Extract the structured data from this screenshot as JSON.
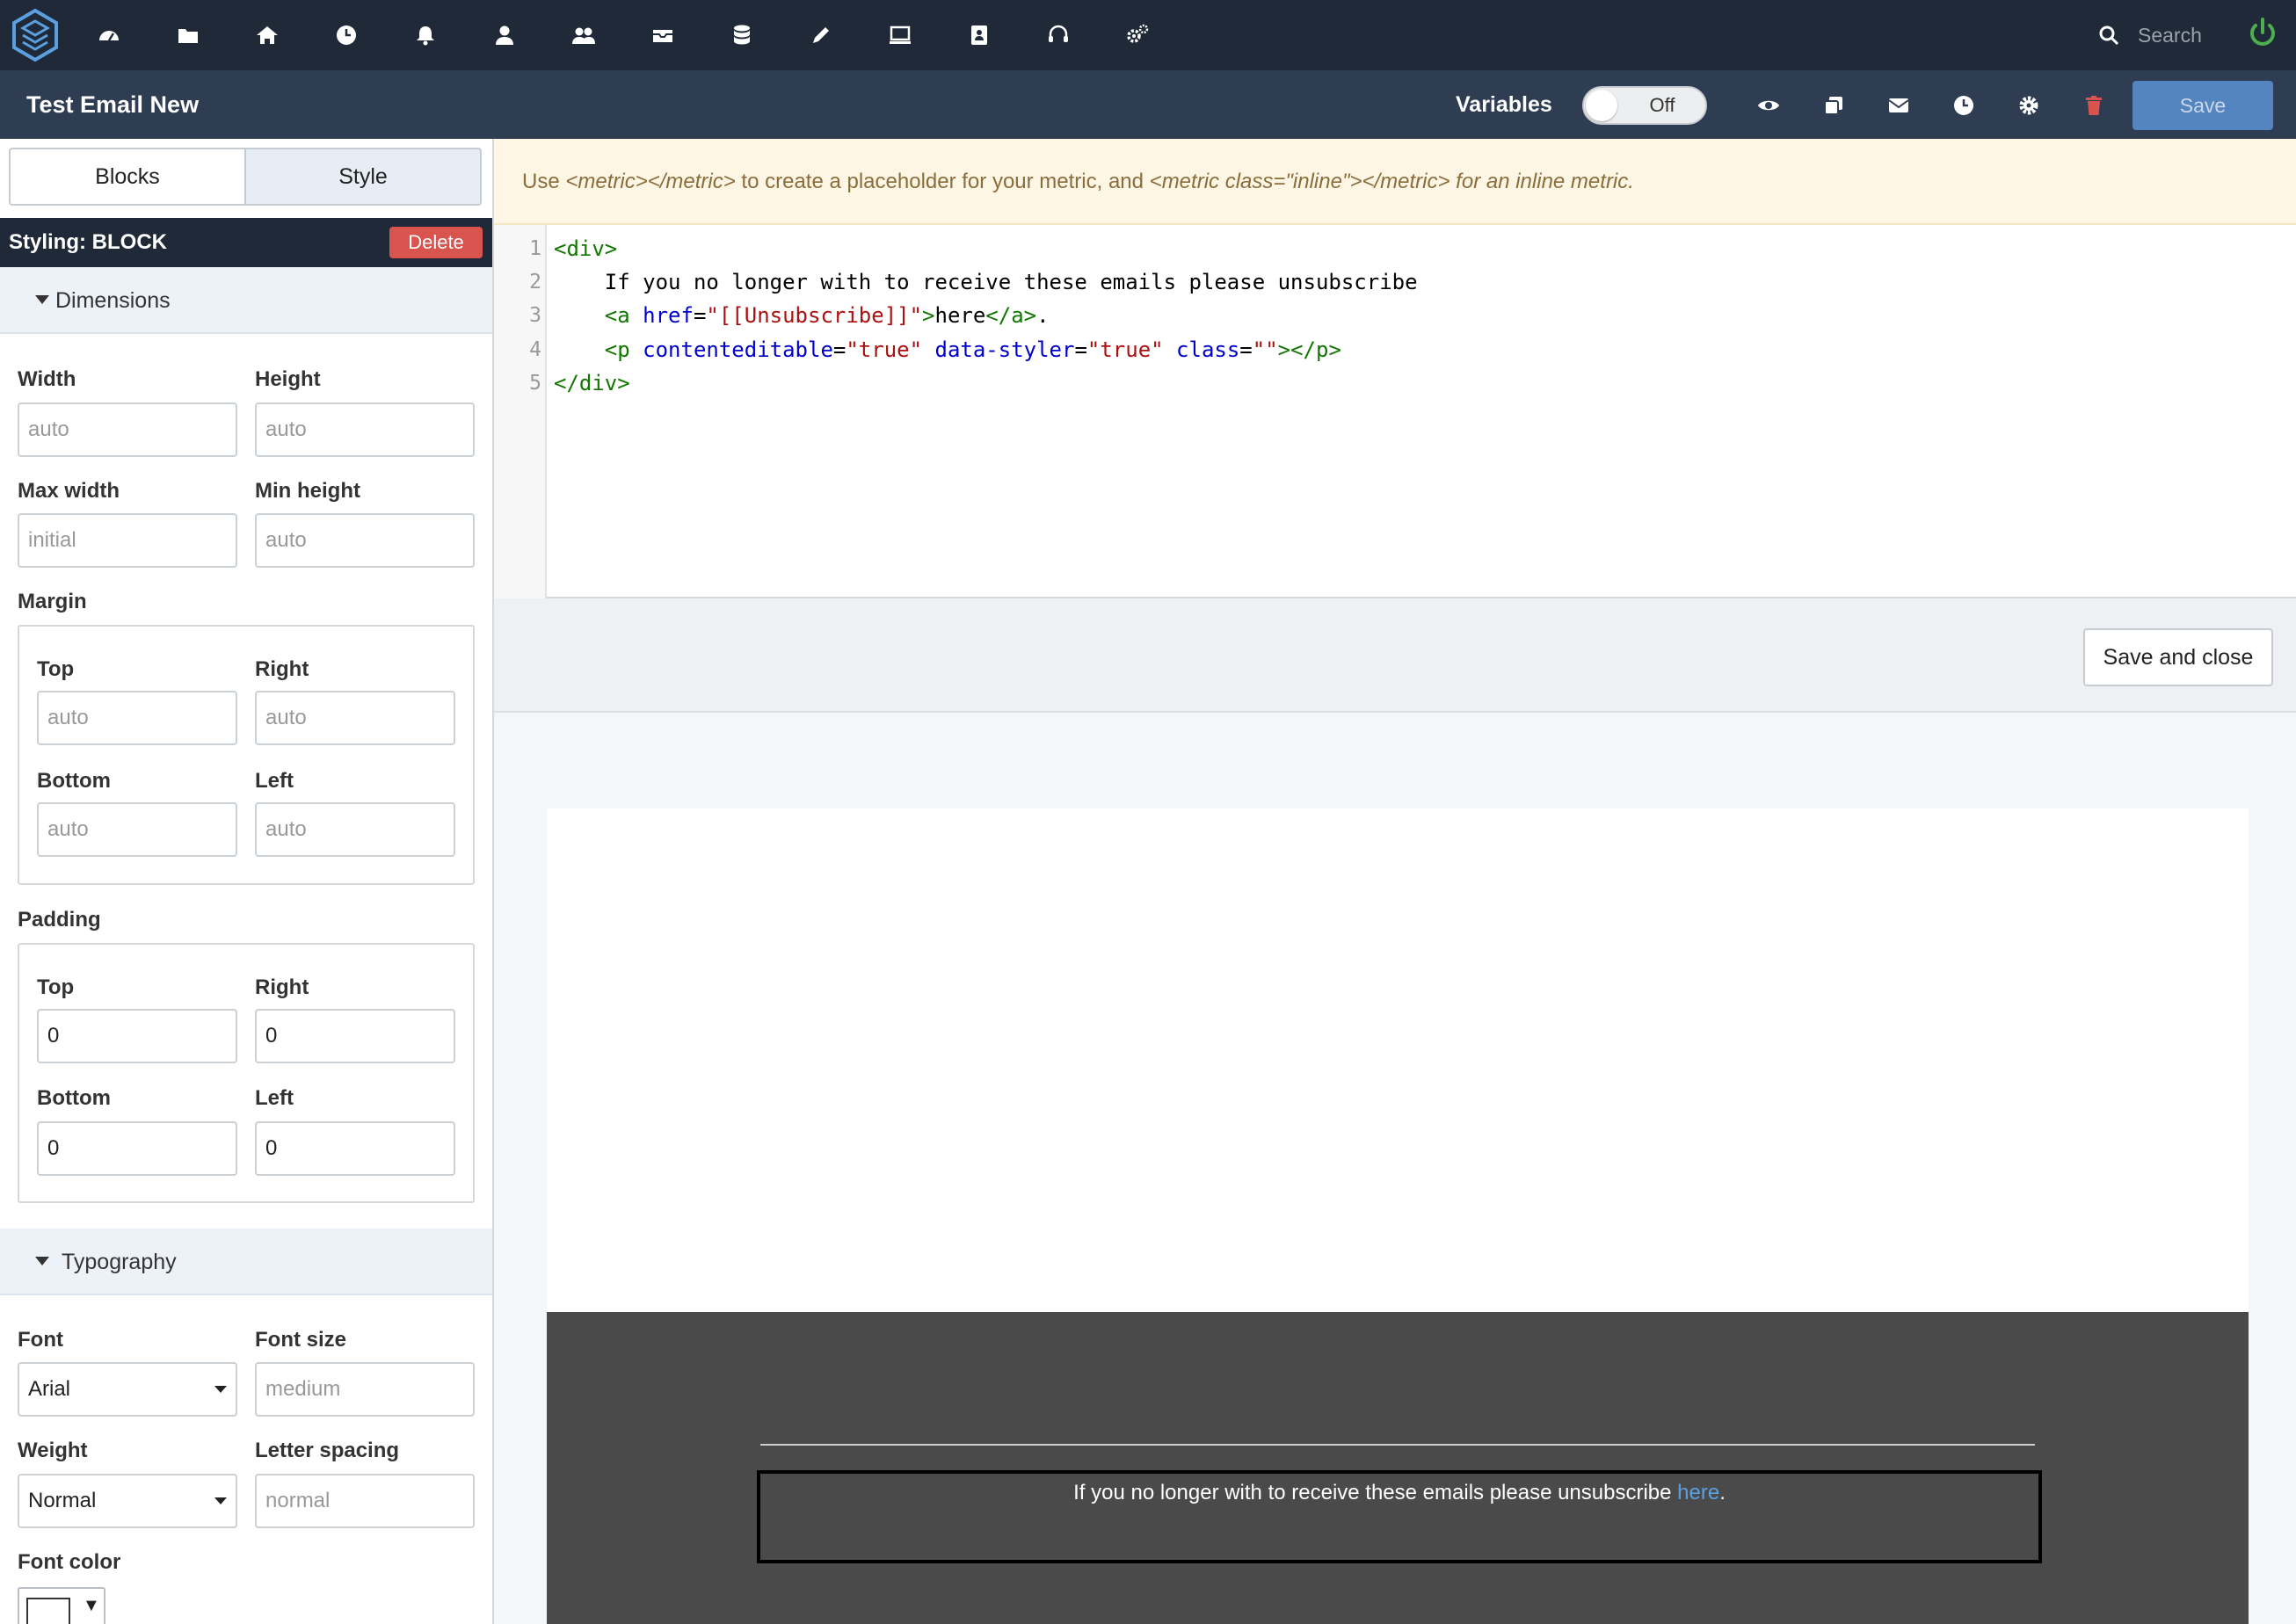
{
  "app": {
    "nav_icons": [
      "dashboard-icon",
      "folder-icon",
      "home-icon",
      "clock-icon",
      "bell-icon",
      "user-icon",
      "users-icon",
      "tray-icon",
      "database-icon",
      "pencil-icon",
      "monitor-icon",
      "address-book-icon",
      "headset-icon",
      "cogs-icon"
    ],
    "search_placeholder": "Search"
  },
  "titlebar": {
    "title": "Test Email New",
    "variables_label": "Variables",
    "variables_toggle": "Off",
    "save_label": "Save",
    "icons": [
      "eye-icon",
      "copy-icon",
      "envelope-icon",
      "clock-icon",
      "gear-icon",
      "trash-icon"
    ]
  },
  "sidebar": {
    "tabs": {
      "blocks": "Blocks",
      "style": "Style"
    },
    "styling_label": "Styling: BLOCK",
    "delete_label": "Delete",
    "dimensions": {
      "title": "Dimensions",
      "width": {
        "label": "Width",
        "placeholder": "auto"
      },
      "height": {
        "label": "Height",
        "placeholder": "auto"
      },
      "max_width": {
        "label": "Max width",
        "placeholder": "initial"
      },
      "min_height": {
        "label": "Min height",
        "placeholder": "auto"
      },
      "margin": {
        "label": "Margin",
        "top": {
          "label": "Top",
          "placeholder": "auto"
        },
        "right": {
          "label": "Right",
          "placeholder": "auto"
        },
        "bottom": {
          "label": "Bottom",
          "placeholder": "auto"
        },
        "left": {
          "label": "Left",
          "placeholder": "auto"
        }
      },
      "padding": {
        "label": "Padding",
        "top": {
          "label": "Top",
          "value": "0"
        },
        "right": {
          "label": "Right",
          "value": "0"
        },
        "bottom": {
          "label": "Bottom",
          "value": "0"
        },
        "left": {
          "label": "Left",
          "value": "0"
        }
      }
    },
    "typography": {
      "title": "Typography",
      "font": {
        "label": "Font",
        "value": "Arial"
      },
      "font_size": {
        "label": "Font size",
        "placeholder": "medium"
      },
      "weight": {
        "label": "Weight",
        "value": "Normal"
      },
      "letter_spacing": {
        "label": "Letter spacing",
        "placeholder": "normal"
      },
      "font_color": {
        "label": "Font color",
        "value": "#ffffff"
      }
    }
  },
  "main": {
    "notice": {
      "use": "Use ",
      "metric_tag": "<metric></metric>",
      "middle": " to create a placeholder for your metric, and ",
      "inline_tag": "<metric class=\"inline\"></metric>",
      "end": " for an inline metric."
    },
    "editor": {
      "line_numbers": [
        "1",
        "2",
        "3",
        "4",
        "5"
      ],
      "line1": "<div>",
      "line2": "    If you no longer with to receive these emails please unsubscribe",
      "line3_indent": "    ",
      "line3_tag_open": "<a",
      "line3_attr": " href",
      "line3_eq": "=",
      "line3_str": "\"[[Unsubscribe]]\"",
      "line3_close": ">",
      "line3_text": "here",
      "line3_end_tag": "</a>",
      "line3_period": ".",
      "line4_indent": "    ",
      "line4_tag_open": "<p",
      "line4_attr1": " contenteditable",
      "line4_eq1": "=",
      "line4_str1": "\"true\"",
      "line4_attr2": " data-styler",
      "line4_eq2": "=",
      "line4_str2": "\"true\"",
      "line4_attr3": " class",
      "line4_eq3": "=",
      "line4_str3": "\"\"",
      "line4_close": "></p>",
      "line5": "</div>"
    },
    "save_close_label": "Save and close",
    "preview": {
      "text": "If you no longer with to receive these emails please unsubscribe ",
      "link": "here",
      "period": "."
    }
  }
}
